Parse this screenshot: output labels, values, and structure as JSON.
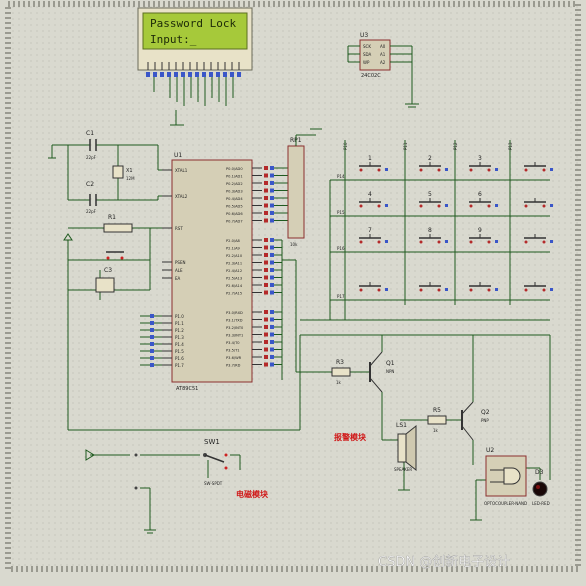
{
  "lcd": {
    "line1": "Password Lock",
    "line2": "Input:_"
  },
  "labels": {
    "u1": "U1",
    "u1_part": "AT89C51",
    "u3": "U3",
    "u3_part": "24C02C",
    "rp1": "RP1",
    "rp1_part": "10k",
    "c1": "C1",
    "c1_val": "22pF",
    "c2": "C2",
    "c2_val": "22pF",
    "c3": "C3",
    "x1": "X1",
    "x1_val": "12M",
    "r1": "R1",
    "r3": "R3",
    "r3_val": "1k",
    "r5": "R5",
    "r5_val": "1k",
    "q1": "Q1",
    "q1_part": "NPN",
    "q2": "Q2",
    "q2_part": "PNP",
    "ls1": "LS1",
    "ls1_part": "SPEAKER",
    "u2": "U2",
    "u2_part": "OPTOCOUPLER-NAND",
    "d3": "D3",
    "d3_part": "LED-RED",
    "sw1": "SW1",
    "sw1_part": "SW-SPDT",
    "alarm": "报警模块",
    "unlock": "电磁模块",
    "watermark": "CSDN @创新电子设计"
  },
  "u1_pins_left": [
    "XTAL1",
    "XTAL2",
    "RST",
    "PSEN",
    "ALE",
    "EA",
    "P1.0",
    "P1.1",
    "P1.2",
    "P1.3",
    "P1.4",
    "P1.5",
    "P1.6",
    "P1.7"
  ],
  "u1_pins_right": [
    "P0.0/AD0",
    "P0.1/AD1",
    "P0.2/AD2",
    "P0.3/AD3",
    "P0.4/AD4",
    "P0.5/AD5",
    "P0.6/AD6",
    "P0.7/AD7",
    "P2.0/A8",
    "P2.1/A9",
    "P2.2/A10",
    "P2.3/A11",
    "P2.4/A12",
    "P2.5/A13",
    "P2.6/A14",
    "P2.7/A15",
    "P3.0/RXD",
    "P3.1/TXD",
    "P3.2/INT0",
    "P3.3/INT1",
    "P3.4/T0",
    "P3.5/T1",
    "P3.6/WR",
    "P3.7/RD"
  ],
  "u3_pins": [
    "SCK",
    "SDA",
    "WP",
    "A0",
    "A1",
    "A2"
  ],
  "key_row_labels": [
    "P14",
    "P15",
    "P16",
    "P17"
  ],
  "key_col_labels": [
    "P10",
    "P11",
    "P12",
    "P13"
  ],
  "keys": [
    "1",
    "2",
    "3",
    "",
    "4",
    "5",
    "6",
    "",
    "7",
    "8",
    "9",
    "",
    "",
    "",
    "",
    ""
  ],
  "colors": {
    "background": "#d9d9cf",
    "lcd": "#a6c93a",
    "wire": "#1f5a1f",
    "chip": "#d5cfb6",
    "chip_border": "#8c2f2f",
    "annotation": "#d01818"
  }
}
